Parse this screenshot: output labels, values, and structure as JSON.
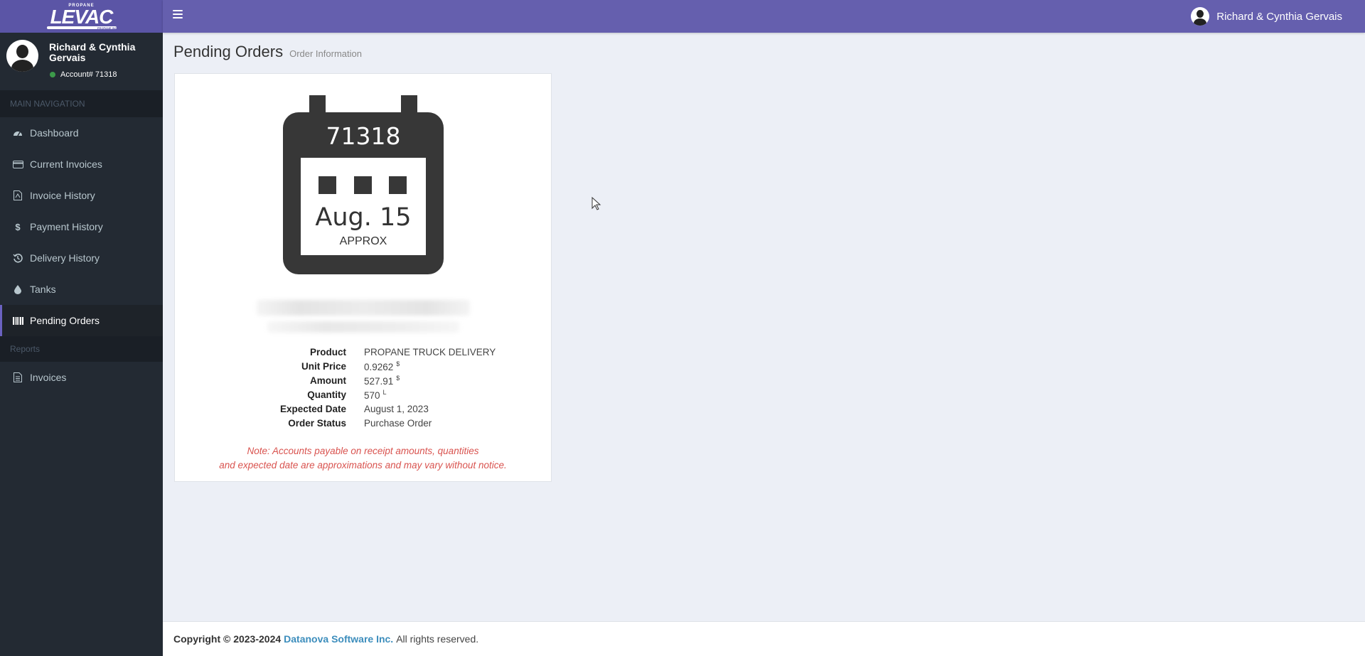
{
  "brand": {
    "top_word": "PROPANE",
    "name": "LEVAC",
    "tag": "PROPANE INC."
  },
  "header": {
    "user_name": "Richard & Cynthia Gervais"
  },
  "sidebar": {
    "user_name": "Richard & Cynthia Gervais",
    "account": "Account# 71318",
    "main_nav_header": "MAIN NAVIGATION",
    "items": [
      {
        "label": "Dashboard",
        "icon": "dashboard-icon"
      },
      {
        "label": "Current Invoices",
        "icon": "credit-card-icon"
      },
      {
        "label": "Invoice History",
        "icon": "pdf-file-icon"
      },
      {
        "label": "Payment History",
        "icon": "dollar-icon"
      },
      {
        "label": "Delivery History",
        "icon": "history-icon"
      },
      {
        "label": "Tanks",
        "icon": "droplet-icon"
      },
      {
        "label": "Pending Orders",
        "icon": "barcode-icon"
      }
    ],
    "reports_header": "Reports",
    "report_items": [
      {
        "label": "Invoices",
        "icon": "file-text-icon"
      }
    ]
  },
  "page": {
    "title": "Pending Orders",
    "subtitle": "Order Information"
  },
  "order": {
    "account_number": "71318",
    "date": "Aug. 15",
    "date_note": "APPROX",
    "fields": [
      {
        "label": "Product",
        "value": "PROPANE TRUCK DELIVERY",
        "unit": ""
      },
      {
        "label": "Unit Price",
        "value": "0.9262",
        "unit": "$"
      },
      {
        "label": "Amount",
        "value": "527.91",
        "unit": "$"
      },
      {
        "label": "Quantity",
        "value": "570",
        "unit": "L"
      },
      {
        "label": "Expected Date",
        "value": "August 1, 2023",
        "unit": ""
      },
      {
        "label": "Order Status",
        "value": "Purchase Order",
        "unit": ""
      }
    ],
    "note_line1": "Note: Accounts payable on receipt amounts, quantities",
    "note_line2": "and expected date are approximations and may vary without notice."
  },
  "footer": {
    "copyright": "Copyright © 2023-2024",
    "company": "Datanova Software Inc.",
    "rights": "All rights reserved."
  },
  "colors": {
    "header": "#655fae",
    "sidebar": "#232a33",
    "accent": "#6b62c0",
    "note": "#d9534f",
    "link": "#3c8dbc"
  }
}
